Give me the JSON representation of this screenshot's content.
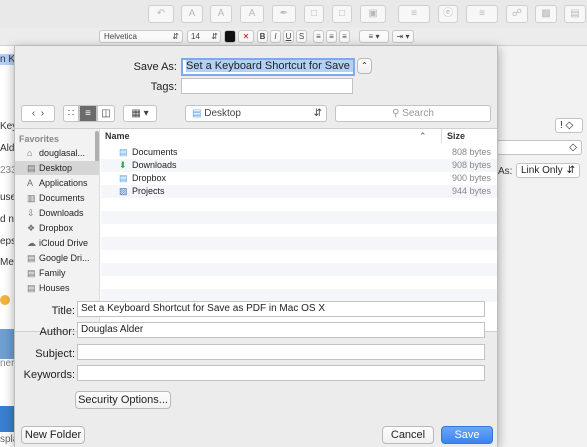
{
  "background": {
    "font_selector": "Helvetica",
    "size_selector": "14",
    "left_fragments": [
      "n Ke",
      "Keyb",
      "Alde",
      "233",
      "use",
      "d na",
      "eps",
      "Me",
      "ner",
      "spla"
    ],
    "right_select_top": "! ◇",
    "right_select_mid": "◇",
    "link_label": "As:",
    "link_select": "Link Only"
  },
  "dialog": {
    "save_as_label": "Save As:",
    "save_as_value": "Set a Keyboard Shortcut for Save as PDF",
    "tags_label": "Tags:",
    "tags_value": "",
    "location": "Desktop",
    "search_placeholder": "Search",
    "sidebar": {
      "heading": "Favorites",
      "items": [
        {
          "label": "douglasal...",
          "icon": "home-icon",
          "glyph": "⌂"
        },
        {
          "label": "Desktop",
          "icon": "desktop-icon",
          "glyph": "▤"
        },
        {
          "label": "Applications",
          "icon": "applications-icon",
          "glyph": "A"
        },
        {
          "label": "Documents",
          "icon": "documents-icon",
          "glyph": "▥"
        },
        {
          "label": "Downloads",
          "icon": "downloads-icon",
          "glyph": "⇩"
        },
        {
          "label": "Dropbox",
          "icon": "dropbox-icon",
          "glyph": "❖"
        },
        {
          "label": "iCloud Drive",
          "icon": "cloud-icon",
          "glyph": "☁"
        },
        {
          "label": "Google Dri...",
          "icon": "folder-icon",
          "glyph": "▤"
        },
        {
          "label": "Family",
          "icon": "folder-icon",
          "glyph": "▤"
        },
        {
          "label": "Houses",
          "icon": "folder-icon",
          "glyph": "▤"
        }
      ]
    },
    "columns": {
      "name": "Name",
      "size": "Size"
    },
    "files": [
      {
        "name": "Documents",
        "size": "808 bytes",
        "icon": "folder-icon",
        "glyph": "▤",
        "color": "#5aa0e6"
      },
      {
        "name": "Downloads",
        "size": "908 bytes",
        "icon": "downloads-icon",
        "glyph": "⬇",
        "color": "#2fa84f"
      },
      {
        "name": "Dropbox",
        "size": "900 bytes",
        "icon": "dropbox-icon",
        "glyph": "▤",
        "color": "#5aa0e6"
      },
      {
        "name": "Projects",
        "size": "944 bytes",
        "icon": "projects-icon",
        "glyph": "▨",
        "color": "#3b6fb6"
      }
    ],
    "meta": {
      "title_label": "Title:",
      "title_value": "Set a Keyboard Shortcut for Save as PDF in Mac OS X",
      "author_label": "Author:",
      "author_value": "Douglas Alder",
      "subject_label": "Subject:",
      "subject_value": "",
      "keywords_label": "Keywords:",
      "keywords_value": ""
    },
    "security_button": "Security Options...",
    "new_folder_button": "New Folder",
    "cancel_button": "Cancel",
    "save_button": "Save"
  },
  "colors": {
    "accent": "#3b83f0",
    "selection": "#b3d1f7"
  }
}
